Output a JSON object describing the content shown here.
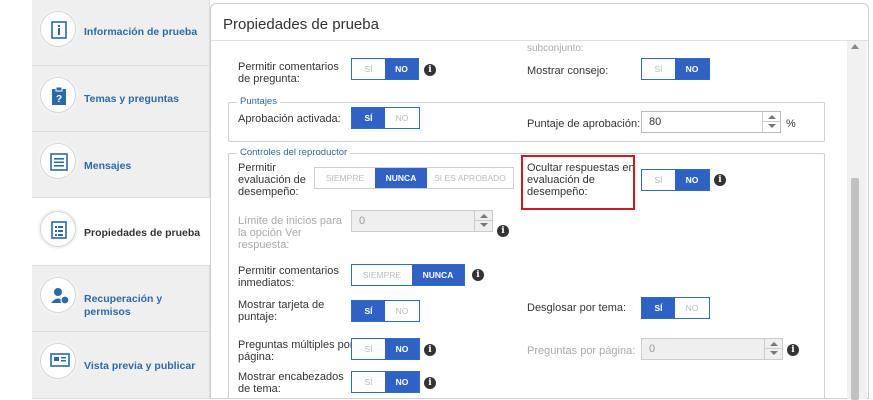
{
  "sidebar": {
    "items": [
      {
        "label": "Información de prueba",
        "icon": "info-document-icon"
      },
      {
        "label": "Temas y preguntas",
        "icon": "question-clipboard-icon"
      },
      {
        "label": "Mensajes",
        "icon": "message-lines-icon"
      },
      {
        "label": "Propiedades de prueba",
        "icon": "properties-list-icon"
      },
      {
        "label": "Recuperación y permisos",
        "icon": "user-permissions-icon"
      },
      {
        "label": "Vista previa y publicar",
        "icon": "preview-screen-icon"
      }
    ]
  },
  "panel": {
    "title": "Propiedades de prueba",
    "top_cut_label": "subconjunto:",
    "rows_top": {
      "permitir_comentarios_pregunta": {
        "label": "Permitir comentarios de pregunta:",
        "options": [
          "SÍ",
          "NO"
        ],
        "selected": "NO"
      },
      "mostrar_consejo": {
        "label": "Mostrar consejo:",
        "options": [
          "SÍ",
          "NO"
        ],
        "selected": "NO"
      }
    },
    "puntajes": {
      "legend": "Puntajes",
      "aprobacion_activada": {
        "label": "Aprobación activada:",
        "options": [
          "SÍ",
          "NO"
        ],
        "selected": "SÍ"
      },
      "puntaje_aprobacion": {
        "label": "Puntaje de aprobación:",
        "value": "80",
        "unit": "%"
      }
    },
    "controles": {
      "legend": "Controles del reproductor",
      "permitir_evaluacion": {
        "label": "Permitir evaluación de desempeño:",
        "options": [
          "SIEMPRE",
          "NUNCA",
          "SI ES APROBADO"
        ],
        "selected": "NUNCA"
      },
      "ocultar_respuestas": {
        "label": "Ocultar respuestas en evaluación de desempeño:",
        "options": [
          "SÍ",
          "NO"
        ],
        "selected": "NO"
      },
      "limite_inicios": {
        "label": "Límite de inicios para la opción Ver respuesta:",
        "value": "0"
      },
      "comentarios_inmediatos": {
        "label": "Permitir comentarios inmediatos:",
        "options": [
          "SIEMPRE",
          "NUNCA"
        ],
        "selected": "NUNCA"
      },
      "mostrar_tarjeta": {
        "label": "Mostrar tarjeta de puntaje:",
        "options": [
          "SÍ",
          "NO"
        ],
        "selected": "SÍ"
      },
      "desglosar_tema": {
        "label": "Desglosar por tema:",
        "options": [
          "SÍ",
          "NO"
        ],
        "selected": "SÍ"
      },
      "preguntas_multiples": {
        "label": "Preguntas múltiples por página:",
        "options": [
          "SÍ",
          "NO"
        ],
        "selected": "NO"
      },
      "preguntas_por_pagina": {
        "label": "Preguntas por página:",
        "value": "0"
      },
      "mostrar_encabezados": {
        "label": "Mostrar encabezados de tema:",
        "options": [
          "SÍ",
          "NO"
        ],
        "selected": "NO"
      }
    },
    "info_icon_glyph": "i"
  },
  "colors": {
    "accent": "#2f62c4",
    "link": "#2b6aa8",
    "highlight": "#d0191f"
  }
}
